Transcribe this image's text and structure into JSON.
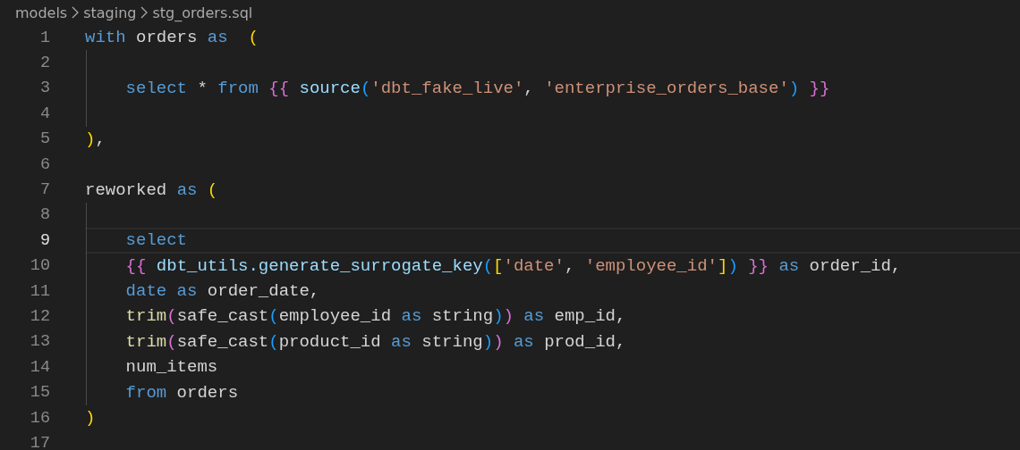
{
  "breadcrumb": [
    "models",
    "staging",
    "stg_orders.sql"
  ],
  "lines": [
    {
      "number": "1",
      "current": false,
      "indent_guide": false,
      "tokens": [
        {
          "text": "with",
          "kind": "keyword"
        },
        {
          "text": " orders ",
          "kind": "plain"
        },
        {
          "text": "as",
          "kind": "keyword"
        },
        {
          "text": "  (",
          "kind": "bracket1"
        }
      ]
    },
    {
      "number": "2",
      "current": false,
      "indent_guide": true
    },
    {
      "number": "3",
      "current": false,
      "indent_guide": true,
      "tokens": [
        {
          "text": "    select",
          "kind": "keyword"
        },
        {
          "text": " * ",
          "kind": "plain"
        },
        {
          "text": "from",
          "kind": "keyword"
        },
        {
          "text": " {{",
          "kind": "bracket2"
        },
        {
          "text": " source",
          "kind": "variable"
        },
        {
          "text": "(",
          "kind": "bracket3"
        },
        {
          "text": "'dbt_fake_live'",
          "kind": "string"
        },
        {
          "text": ", ",
          "kind": "plain"
        },
        {
          "text": "'enterprise_orders_base'",
          "kind": "string"
        },
        {
          "text": ")",
          "kind": "bracket3"
        },
        {
          "text": " }}",
          "kind": "bracket2"
        }
      ]
    },
    {
      "number": "4",
      "current": false,
      "indent_guide": true
    },
    {
      "number": "5",
      "current": false,
      "indent_guide": false,
      "tokens": [
        {
          "text": ")",
          "kind": "bracket1"
        },
        {
          "text": ",",
          "kind": "plain"
        }
      ]
    },
    {
      "number": "6",
      "current": false,
      "indent_guide": false
    },
    {
      "number": "7",
      "current": false,
      "indent_guide": false,
      "tokens": [
        {
          "text": "reworked ",
          "kind": "plain"
        },
        {
          "text": "as",
          "kind": "keyword"
        },
        {
          "text": " (",
          "kind": "bracket1"
        }
      ]
    },
    {
      "number": "8",
      "current": false,
      "indent_guide": true
    },
    {
      "number": "9",
      "current": true,
      "indent_guide": true,
      "tokens": [
        {
          "text": "    select",
          "kind": "keyword"
        }
      ]
    },
    {
      "number": "10",
      "current": false,
      "indent_guide": true,
      "tokens": [
        {
          "text": "    {{",
          "kind": "bracket2"
        },
        {
          "text": " dbt_utils.generate_surrogate_key",
          "kind": "variable"
        },
        {
          "text": "(",
          "kind": "bracket3"
        },
        {
          "text": "[",
          "kind": "bracket1"
        },
        {
          "text": "'date'",
          "kind": "string"
        },
        {
          "text": ", ",
          "kind": "plain"
        },
        {
          "text": "'employee_id'",
          "kind": "string"
        },
        {
          "text": "]",
          "kind": "bracket1"
        },
        {
          "text": ")",
          "kind": "bracket3"
        },
        {
          "text": " }}",
          "kind": "bracket2"
        },
        {
          "text": " as",
          "kind": "keyword"
        },
        {
          "text": " order_id,",
          "kind": "plain"
        }
      ]
    },
    {
      "number": "11",
      "current": false,
      "indent_guide": true,
      "tokens": [
        {
          "text": "    date",
          "kind": "keyword"
        },
        {
          "text": " as",
          "kind": "keyword"
        },
        {
          "text": " order_date,",
          "kind": "plain"
        }
      ]
    },
    {
      "number": "12",
      "current": false,
      "indent_guide": true,
      "tokens": [
        {
          "text": "    trim",
          "kind": "function"
        },
        {
          "text": "(",
          "kind": "bracket2"
        },
        {
          "text": "safe_cast",
          "kind": "plain"
        },
        {
          "text": "(",
          "kind": "bracket3"
        },
        {
          "text": "employee_id ",
          "kind": "plain"
        },
        {
          "text": "as",
          "kind": "keyword"
        },
        {
          "text": " string",
          "kind": "plain"
        },
        {
          "text": ")",
          "kind": "bracket3"
        },
        {
          "text": ")",
          "kind": "bracket2"
        },
        {
          "text": " as",
          "kind": "keyword"
        },
        {
          "text": " emp_id,",
          "kind": "plain"
        }
      ]
    },
    {
      "number": "13",
      "current": false,
      "indent_guide": true,
      "tokens": [
        {
          "text": "    trim",
          "kind": "function"
        },
        {
          "text": "(",
          "kind": "bracket2"
        },
        {
          "text": "safe_cast",
          "kind": "plain"
        },
        {
          "text": "(",
          "kind": "bracket3"
        },
        {
          "text": "product_id ",
          "kind": "plain"
        },
        {
          "text": "as",
          "kind": "keyword"
        },
        {
          "text": " string",
          "kind": "plain"
        },
        {
          "text": ")",
          "kind": "bracket3"
        },
        {
          "text": ")",
          "kind": "bracket2"
        },
        {
          "text": " as",
          "kind": "keyword"
        },
        {
          "text": " prod_id,",
          "kind": "plain"
        }
      ]
    },
    {
      "number": "14",
      "current": false,
      "indent_guide": true,
      "tokens": [
        {
          "text": "    num_items",
          "kind": "plain"
        }
      ]
    },
    {
      "number": "15",
      "current": false,
      "indent_guide": true,
      "tokens": [
        {
          "text": "    from",
          "kind": "keyword"
        },
        {
          "text": " orders",
          "kind": "plain"
        }
      ]
    },
    {
      "number": "16",
      "current": false,
      "indent_guide": false,
      "tokens": [
        {
          "text": ")",
          "kind": "bracket1"
        }
      ]
    },
    {
      "number": "17",
      "current": false,
      "indent_guide": false
    }
  ]
}
